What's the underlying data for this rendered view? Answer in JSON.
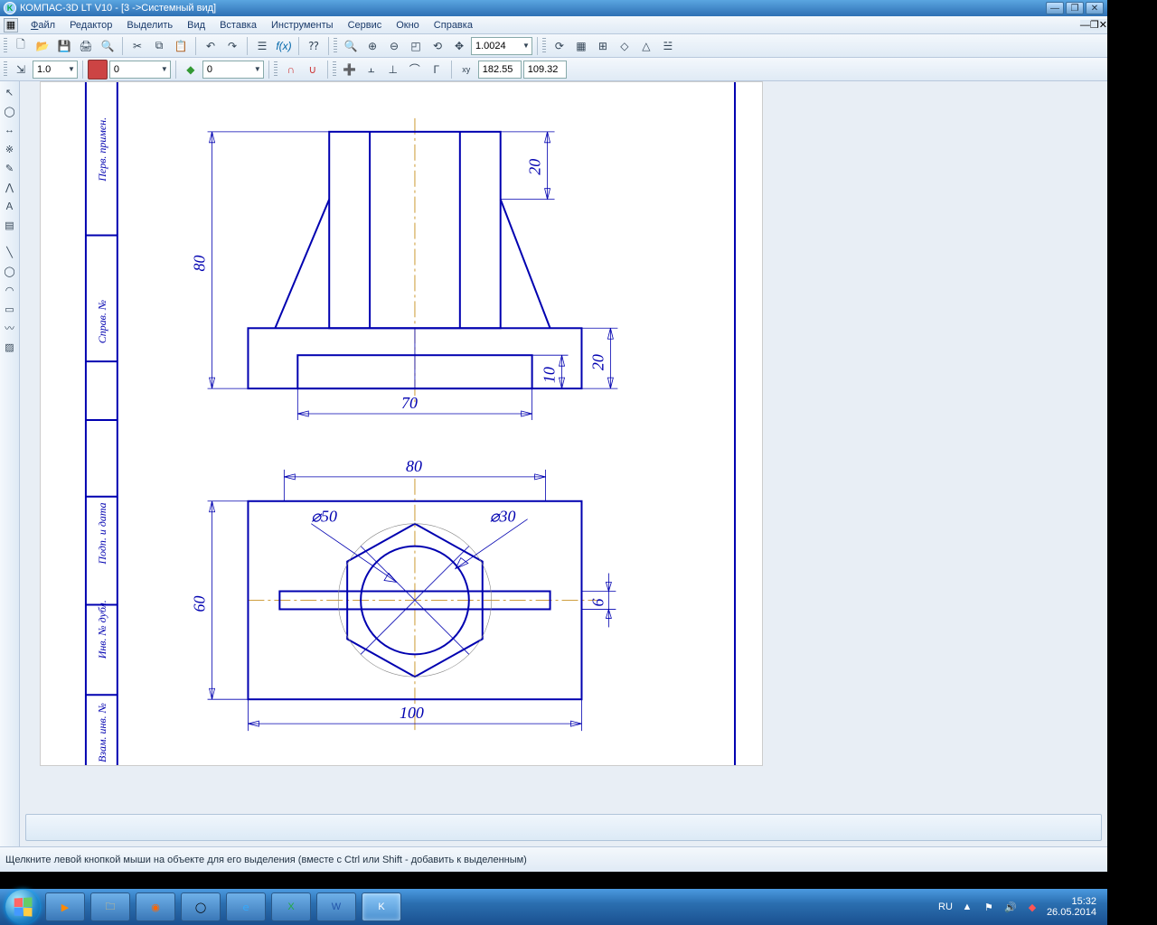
{
  "title": "КОМПАС-3D LT V10 - [3 ->Системный вид]",
  "menu": {
    "file": "Файл",
    "edit": "Редактор",
    "select": "Выделить",
    "view": "Вид",
    "insert": "Вставка",
    "tools": "Инструменты",
    "service": "Сервис",
    "window": "Окно",
    "help": "Справка"
  },
  "toolbar1": {
    "zoom": "1.0024"
  },
  "toolbar2": {
    "step": "1.0",
    "style": "0",
    "layer": "0",
    "coordX": "182.55",
    "coordY": "109.32"
  },
  "status_text": "Щелкните левой кнопкой мыши на объекте для его выделения (вместе с Ctrl или Shift - добавить к выделенным)",
  "frame": {
    "col1": "Перв. примен.",
    "col2": "Справ. №",
    "col3": "Подп. и дата",
    "col4": "Инв. № дубл.",
    "col5": "Взам. инв. №"
  },
  "dims": {
    "h80": "80",
    "h20t": "20",
    "w70": "70",
    "r10": "10",
    "r20": "20",
    "t80": "80",
    "d50": "⌀50",
    "d30": "⌀30",
    "h60": "60",
    "w100": "100",
    "g6": "6"
  },
  "tray": {
    "lang": "RU",
    "time": "15:32",
    "date": "26.05.2014"
  }
}
